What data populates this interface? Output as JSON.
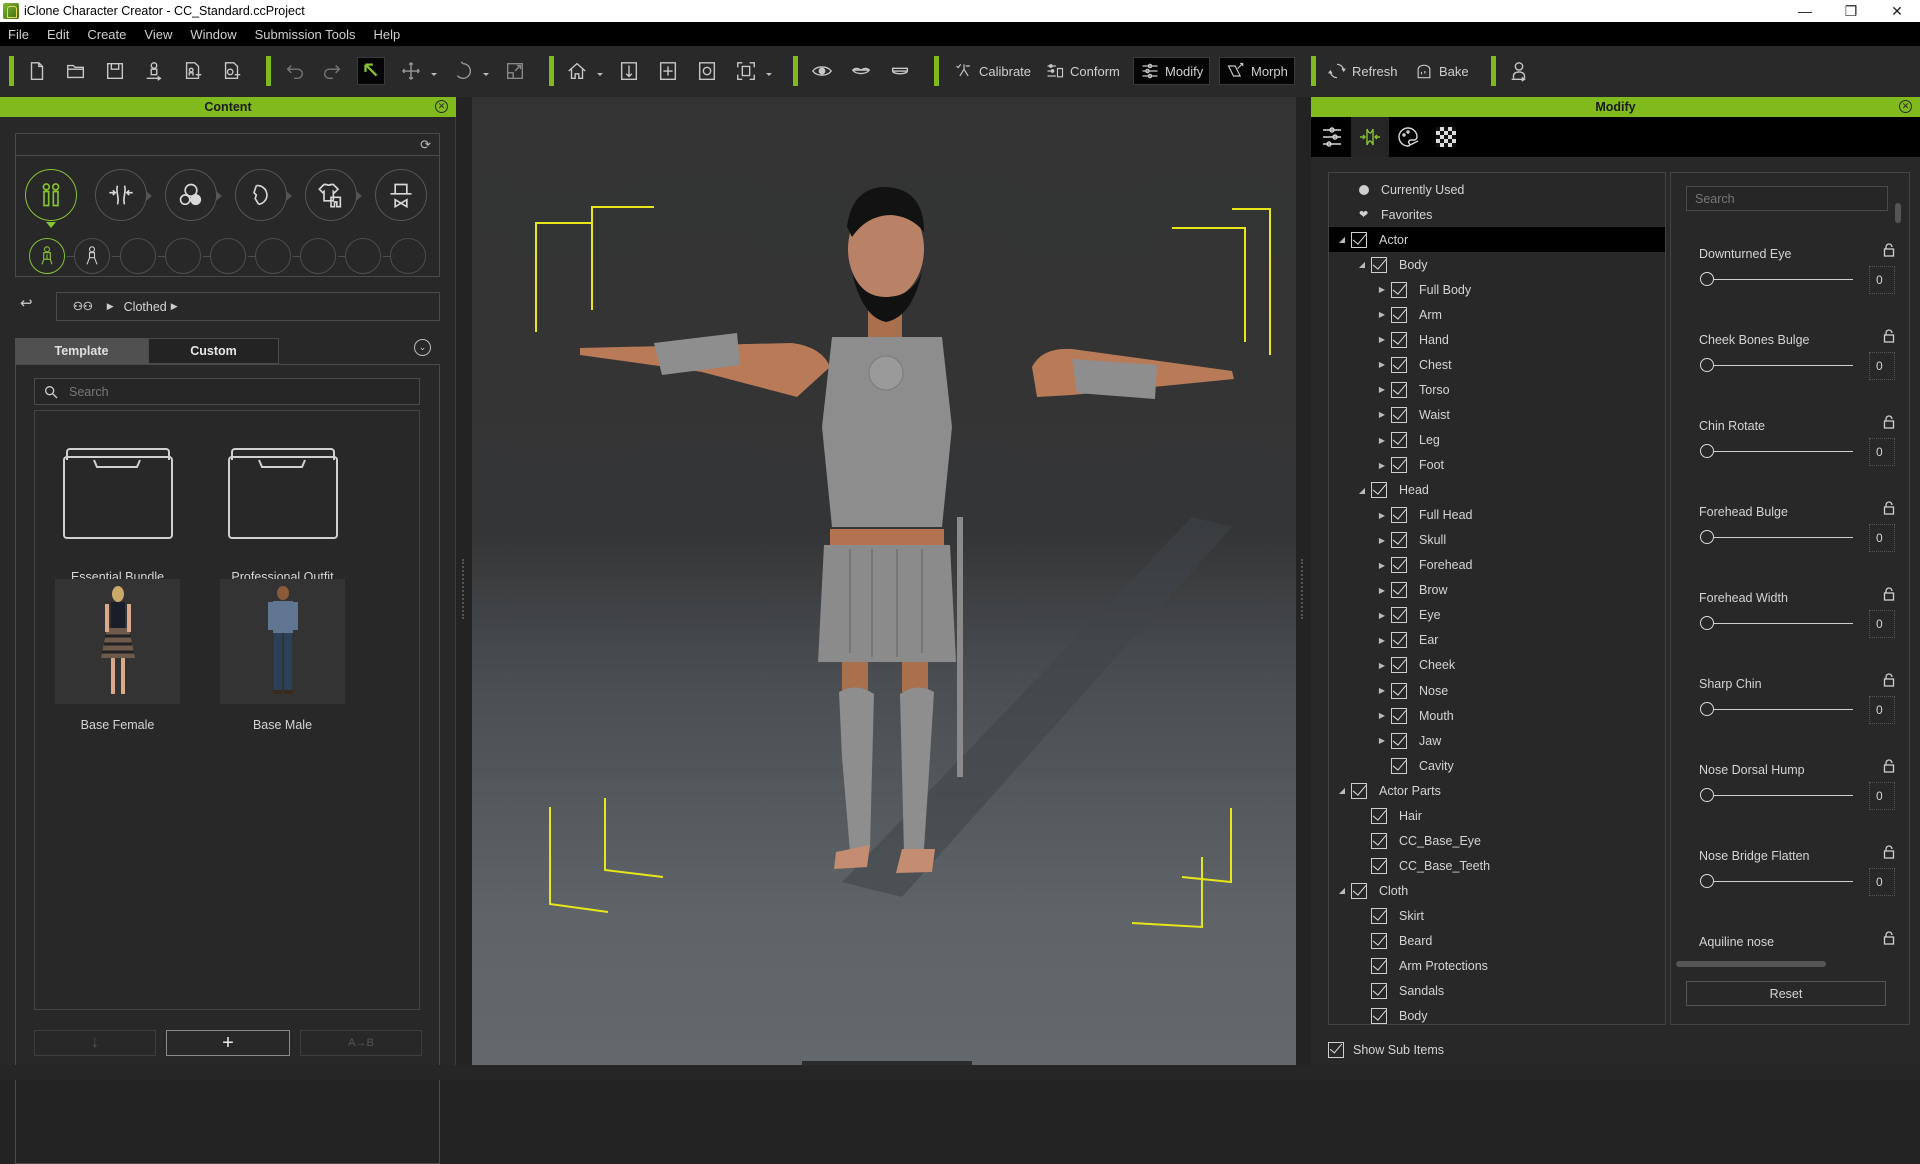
{
  "window": {
    "title": "iClone Character Creator - CC_Standard.ccProject",
    "controls": [
      "minimize",
      "restore",
      "close"
    ]
  },
  "menu": [
    "File",
    "Edit",
    "Create",
    "View",
    "Window",
    "Submission Tools",
    "Help"
  ],
  "toolbar": {
    "calibrate": "Calibrate",
    "conform": "Conform",
    "modify": "Modify",
    "morph": "Morph",
    "refresh": "Refresh",
    "bake": "Bake"
  },
  "content_panel": {
    "title": "Content",
    "breadcrumb": [
      "Clothed"
    ],
    "tabs": [
      {
        "label": "Template",
        "active": true
      },
      {
        "label": "Custom",
        "active": false
      }
    ],
    "search_placeholder": "Search",
    "items": [
      {
        "label": "Essential Bundle",
        "type": "folder"
      },
      {
        "label": "Professional Outfit",
        "type": "folder"
      },
      {
        "label": "Base Female",
        "type": "character"
      },
      {
        "label": "Base Male",
        "type": "character"
      }
    ],
    "bottom_buttons": [
      "down-arrow",
      "add",
      "apply"
    ]
  },
  "modify_panel": {
    "title": "Modify",
    "tabs": [
      "parameters-icon",
      "morph-icon",
      "material-icon",
      "texture-icon"
    ],
    "active_tab": 1,
    "tree": [
      {
        "label": "Currently Used",
        "level": 0,
        "type": "bullet"
      },
      {
        "label": "Favorites",
        "level": 0,
        "type": "heart"
      },
      {
        "label": "Actor",
        "level": 0,
        "expand": "open",
        "checked": true,
        "selected": true
      },
      {
        "label": "Body",
        "level": 1,
        "expand": "open",
        "checked": true
      },
      {
        "label": "Full Body",
        "level": 2,
        "expand": "closed",
        "checked": true
      },
      {
        "label": "Arm",
        "level": 2,
        "expand": "closed",
        "checked": true
      },
      {
        "label": "Hand",
        "level": 2,
        "expand": "closed",
        "checked": true
      },
      {
        "label": "Chest",
        "level": 2,
        "expand": "closed",
        "checked": true
      },
      {
        "label": "Torso",
        "level": 2,
        "expand": "closed",
        "checked": true
      },
      {
        "label": "Waist",
        "level": 2,
        "expand": "closed",
        "checked": true
      },
      {
        "label": "Leg",
        "level": 2,
        "expand": "closed",
        "checked": true
      },
      {
        "label": "Foot",
        "level": 2,
        "expand": "closed",
        "checked": true
      },
      {
        "label": "Head",
        "level": 1,
        "expand": "open",
        "checked": true
      },
      {
        "label": "Full Head",
        "level": 2,
        "expand": "closed",
        "checked": true
      },
      {
        "label": "Skull",
        "level": 2,
        "expand": "closed",
        "checked": true
      },
      {
        "label": "Forehead",
        "level": 2,
        "expand": "closed",
        "checked": true
      },
      {
        "label": "Brow",
        "level": 2,
        "expand": "closed",
        "checked": true
      },
      {
        "label": "Eye",
        "level": 2,
        "expand": "closed",
        "checked": true
      },
      {
        "label": "Ear",
        "level": 2,
        "expand": "closed",
        "checked": true
      },
      {
        "label": "Cheek",
        "level": 2,
        "expand": "closed",
        "checked": true
      },
      {
        "label": "Nose",
        "level": 2,
        "expand": "closed",
        "checked": true
      },
      {
        "label": "Mouth",
        "level": 2,
        "expand": "closed",
        "checked": true
      },
      {
        "label": "Jaw",
        "level": 2,
        "expand": "closed",
        "checked": true
      },
      {
        "label": "Cavity",
        "level": 2,
        "expand": "none",
        "checked": true
      },
      {
        "label": "Actor Parts",
        "level": 0,
        "expand": "open",
        "checked": true
      },
      {
        "label": "Hair",
        "level": 1,
        "expand": "none",
        "checked": true
      },
      {
        "label": "CC_Base_Eye",
        "level": 1,
        "expand": "none",
        "checked": true
      },
      {
        "label": "CC_Base_Teeth",
        "level": 1,
        "expand": "none",
        "checked": true
      },
      {
        "label": "Cloth",
        "level": 0,
        "expand": "open",
        "checked": true
      },
      {
        "label": "Skirt",
        "level": 1,
        "expand": "none",
        "checked": true
      },
      {
        "label": "Beard",
        "level": 1,
        "expand": "none",
        "checked": true
      },
      {
        "label": "Arm Protections",
        "level": 1,
        "expand": "none",
        "checked": true
      },
      {
        "label": "Sandals",
        "level": 1,
        "expand": "none",
        "checked": true
      },
      {
        "label": "Body",
        "level": 1,
        "expand": "none",
        "checked": true
      }
    ],
    "slider_search_placeholder": "Search",
    "sliders": [
      {
        "label": "Downturned Eye",
        "value": 0
      },
      {
        "label": "Cheek Bones Bulge",
        "value": 0
      },
      {
        "label": "Chin Rotate",
        "value": 0
      },
      {
        "label": "Forehead Bulge",
        "value": 0
      },
      {
        "label": "Forehead Width",
        "value": 0
      },
      {
        "label": "Sharp Chin",
        "value": 0
      },
      {
        "label": "Nose Dorsal Hump",
        "value": 0
      },
      {
        "label": "Nose Bridge Flatten",
        "value": 0
      },
      {
        "label": "Aquiline nose",
        "value": null
      }
    ],
    "reset_label": "Reset",
    "show_sub_items_label": "Show Sub Items",
    "show_sub_items_checked": true
  },
  "colors": {
    "accent": "#80ba1c",
    "bracket": "#e6e619",
    "panel_bg": "#282828"
  }
}
